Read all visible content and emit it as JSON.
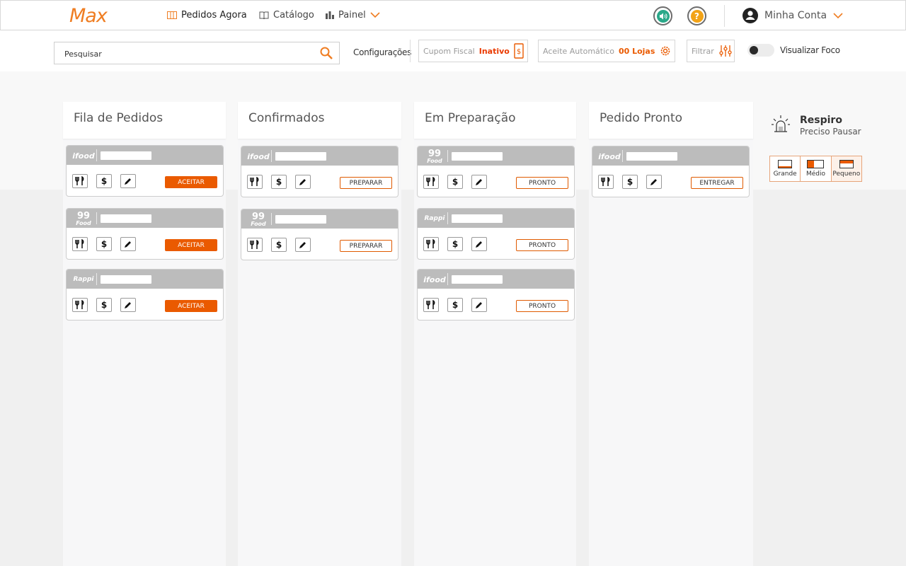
{
  "header": {
    "logo": "Max",
    "nav": [
      {
        "label": "Pedidos Agora",
        "icon": "columns-icon"
      },
      {
        "label": "Catálogo",
        "icon": "book-icon"
      },
      {
        "label": "Painel",
        "icon": "bar-chart-icon"
      }
    ],
    "account_label": "Minha Conta"
  },
  "toolbar": {
    "search_placeholder": "Pesquisar",
    "config_label": "Configurações",
    "fiscal_label": "Cupom Fiscal",
    "fiscal_status": "Inativo",
    "auto_label": "Aceite Automático",
    "auto_value": "00 Lojas",
    "filter_label": "Filtrar",
    "focus_label": "Visualizar Foco"
  },
  "columns": [
    {
      "title": "Fila de Pedidos",
      "cards": [
        {
          "brand": "ifood",
          "action": "ACEITAR"
        },
        {
          "brand": "99food",
          "action": "ACEITAR"
        },
        {
          "brand": "rappi",
          "action": "ACEITAR"
        }
      ]
    },
    {
      "title": "Confirmados",
      "cards": [
        {
          "brand": "ifood",
          "action": "PREPARAR"
        },
        {
          "brand": "99food",
          "action": "PREPARAR"
        }
      ]
    },
    {
      "title": "Em Preparação",
      "cards": [
        {
          "brand": "99food",
          "action": "PRONTO"
        },
        {
          "brand": "rappi",
          "action": "PRONTO"
        },
        {
          "brand": "ifood",
          "action": "PRONTO"
        }
      ]
    },
    {
      "title": "Pedido Pronto",
      "cards": [
        {
          "brand": "ifood",
          "action": "ENTREGAR"
        }
      ]
    }
  ],
  "side_panel": {
    "respiro_title": "Respiro",
    "respiro_subtitle": "Preciso Pausar",
    "sizes": [
      "Grande",
      "Médio",
      "Pequeno"
    ]
  },
  "brand_text": {
    "ifood": "ifood",
    "99food_top": "99",
    "99food_bottom": "Food",
    "rappi": "Rappi"
  },
  "colors": {
    "accent": "#ea5a00",
    "logo": "#ef7d22",
    "sound_icon": "#2aa889",
    "help_icon": "#f2a317"
  }
}
